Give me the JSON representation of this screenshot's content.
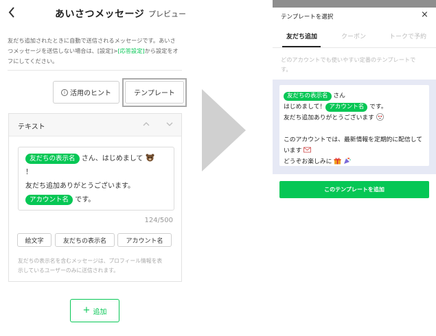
{
  "left": {
    "header": {
      "title": "あいさつメッセージ",
      "preview_label": "プレビュー"
    },
    "description": {
      "line1": "友だち追加されたときに自動で送信されるメッセージです。あいさ",
      "line2_a": "つメッセージを送信しない場合は、[設定]>",
      "line2_link": "[応答設定]",
      "line2_b": "から設定をオ",
      "line3": "フにしてください。"
    },
    "hint_button": "活用のヒント",
    "template_button": "テンプレート",
    "editor": {
      "section_label": "テキスト",
      "token_display_name": "友だちの表示名",
      "text_after_name": " さん、はじめまして",
      "text_exclaim": "！",
      "text_line2": "友だち追加ありがとうございます。",
      "token_account_name": "アカウント名",
      "text_after_account": " です。",
      "counter": "124/500",
      "chips": [
        "絵文字",
        "友だちの表示名",
        "アカウント名"
      ],
      "note_line1": "友だちの表示名を含むメッセージは、プロフィール情報を表",
      "note_line2": "示しているユーザーのみに送信されます。"
    },
    "add_button": "追加"
  },
  "right": {
    "title": "テンプレートを選択",
    "close_glyph": "×",
    "tabs": [
      "友だち追加",
      "クーポン",
      "トークで予約"
    ],
    "description_line1": "どのアカウントでも使いやすい定番のテンプレートで",
    "description_line2": "す。",
    "template": {
      "token_display_name": "友だちの表示名",
      "san": " さん",
      "greeting": "はじめまして！",
      "token_account_name": "アカウント名",
      "desu": " です。",
      "thanks": "友だち追加ありがとうございます",
      "info_line1": "このアカウントでは、最新情報を定期的に配信して",
      "info_line2": "います",
      "enjoy": "どうぞお楽しみに"
    },
    "add_template_button": "このテンプレートを追加"
  },
  "colors": {
    "accent": "#06c755",
    "highlight_border": "#a9a9a9",
    "template_bg": "#e6e9f5",
    "arrow": "#d0d0d0"
  },
  "icons": [
    "back-chevron-icon",
    "info-circle-icon",
    "chevron-up-icon",
    "chevron-down-icon",
    "bear-emoji-icon",
    "plus-icon",
    "close-icon",
    "envelope-emoji-icon",
    "gift-emoji-icon",
    "party-emoji-icon",
    "pleading-emoji-icon"
  ]
}
